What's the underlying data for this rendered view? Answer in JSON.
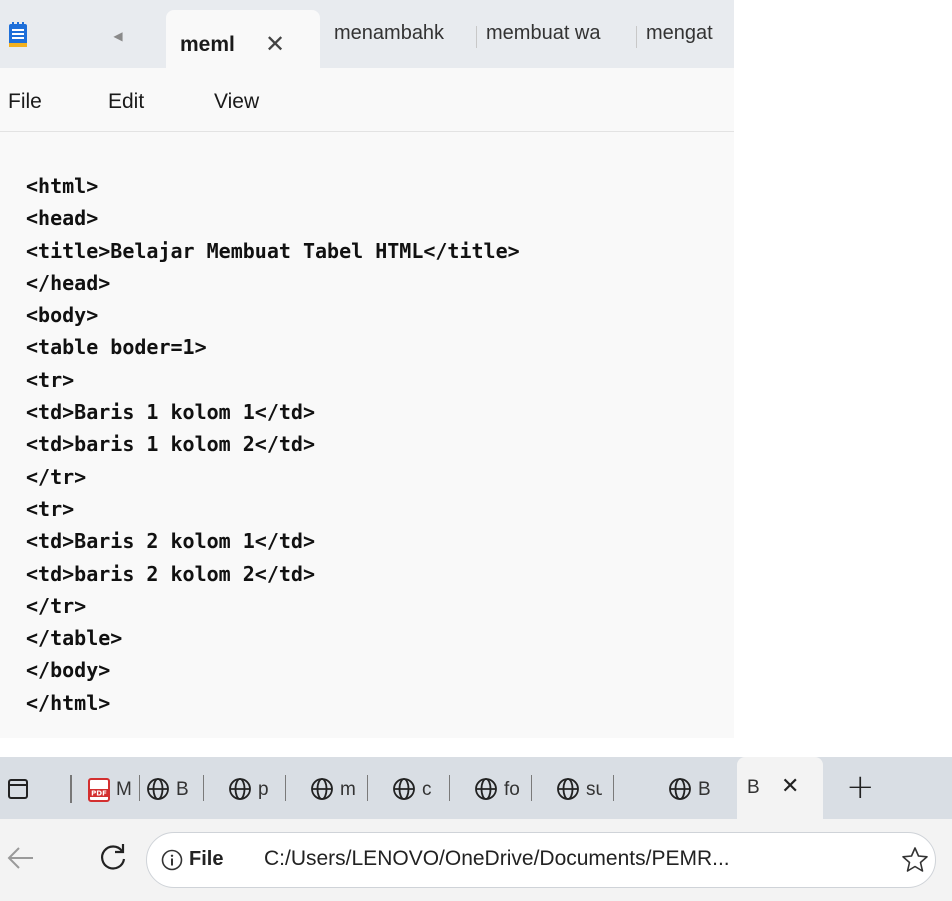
{
  "notepad": {
    "tabs": {
      "active": {
        "label": "meml",
        "close": "✕"
      },
      "others": [
        "menambahk",
        "membuat wa",
        "mengat"
      ]
    },
    "menu": [
      "File",
      "Edit",
      "View"
    ],
    "code_lines": [
      "<html>",
      "<head>",
      "<title>Belajar Membuat Tabel HTML</title>",
      "</head>",
      "<body>",
      "<table boder=1>",
      "<tr>",
      "<td>Baris 1 kolom 1</td>",
      "<td>baris 1 kolom 2</td>",
      "</tr>",
      "<tr>",
      "<td>Baris 2 kolom 1</td>",
      "<td>baris 2 kolom 2</td>",
      "</tr>",
      "</table>",
      "</body>",
      "</html>"
    ]
  },
  "browser": {
    "tabs": {
      "pdf_tab_title": "M",
      "mini_tab_titles": [
        "B",
        "p",
        "m",
        "c",
        "fo",
        "su",
        "B"
      ],
      "active": {
        "label": "B",
        "close": "✕"
      },
      "new_tab": "+"
    },
    "address": {
      "scheme_label": "File",
      "url": "C:/Users/LENOVO/OneDrive/Documents/PEMR..."
    }
  },
  "colors": {
    "notepad_bg": "#f9f9f9",
    "notepad_tabbar": "#e8ebef",
    "browser_tabbar": "#d9dee4",
    "pdf_red": "#d32f2f",
    "notepad_icon_blue": "#1e6fd9"
  }
}
